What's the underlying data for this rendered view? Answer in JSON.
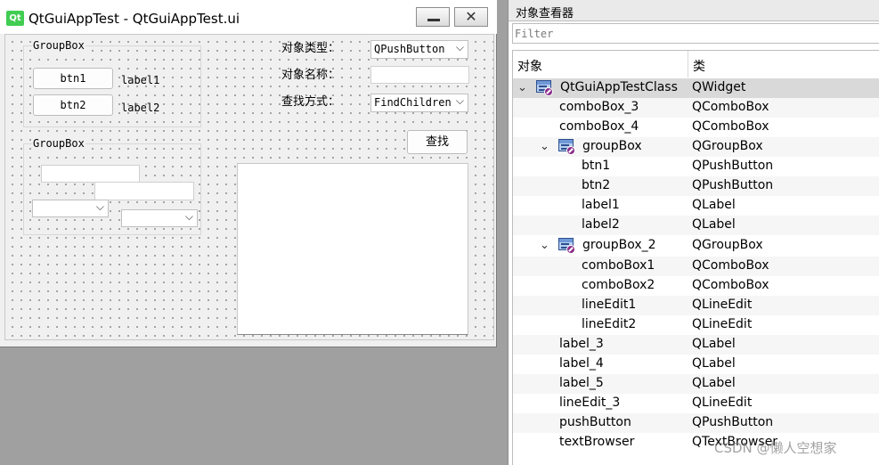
{
  "window": {
    "logo_text": "Qt",
    "title": "QtGuiAppTest - QtGuiAppTest.ui",
    "minimize_glyph": "",
    "close_glyph": "✕"
  },
  "form": {
    "groupbox1": {
      "title": "GroupBox",
      "btn1": "btn1",
      "btn2": "btn2",
      "label1": "label1",
      "label2": "label2"
    },
    "groupbox2": {
      "title": "GroupBox",
      "lineedit1_value": "",
      "lineedit2_value": "",
      "combo1_value": "",
      "combo2_value": ""
    },
    "label_type": "对象类型：",
    "label_name": "对象名称：",
    "label_method": "查找方式：",
    "combo_type_value": "QPushButton",
    "lineedit_name_value": "",
    "combo_method_value": "FindChildren",
    "find_button": "查找",
    "combo_arrow": "⌵"
  },
  "inspector": {
    "title": "对象查看器",
    "filter_placeholder": "Filter",
    "col_object": "对象",
    "col_class": "类",
    "rows": [
      {
        "name": "QtGuiAppTestClass",
        "cls": "QWidget"
      },
      {
        "name": "comboBox_3",
        "cls": "QComboBox"
      },
      {
        "name": "comboBox_4",
        "cls": "QComboBox"
      },
      {
        "name": "groupBox",
        "cls": "QGroupBox"
      },
      {
        "name": "btn1",
        "cls": "QPushButton"
      },
      {
        "name": "btn2",
        "cls": "QPushButton"
      },
      {
        "name": "label1",
        "cls": "QLabel"
      },
      {
        "name": "label2",
        "cls": "QLabel"
      },
      {
        "name": "groupBox_2",
        "cls": "QGroupBox"
      },
      {
        "name": "comboBox1",
        "cls": "QComboBox"
      },
      {
        "name": "comboBox2",
        "cls": "QComboBox"
      },
      {
        "name": "lineEdit1",
        "cls": "QLineEdit"
      },
      {
        "name": "lineEdit2",
        "cls": "QLineEdit"
      },
      {
        "name": "label_3",
        "cls": "QLabel"
      },
      {
        "name": "label_4",
        "cls": "QLabel"
      },
      {
        "name": "label_5",
        "cls": "QLabel"
      },
      {
        "name": "lineEdit_3",
        "cls": "QLineEdit"
      },
      {
        "name": "pushButton",
        "cls": "QPushButton"
      },
      {
        "name": "textBrowser",
        "cls": "QTextBrowser"
      }
    ],
    "expand_glyph": "⌄"
  },
  "watermark": "CSDN @懒人空想家"
}
